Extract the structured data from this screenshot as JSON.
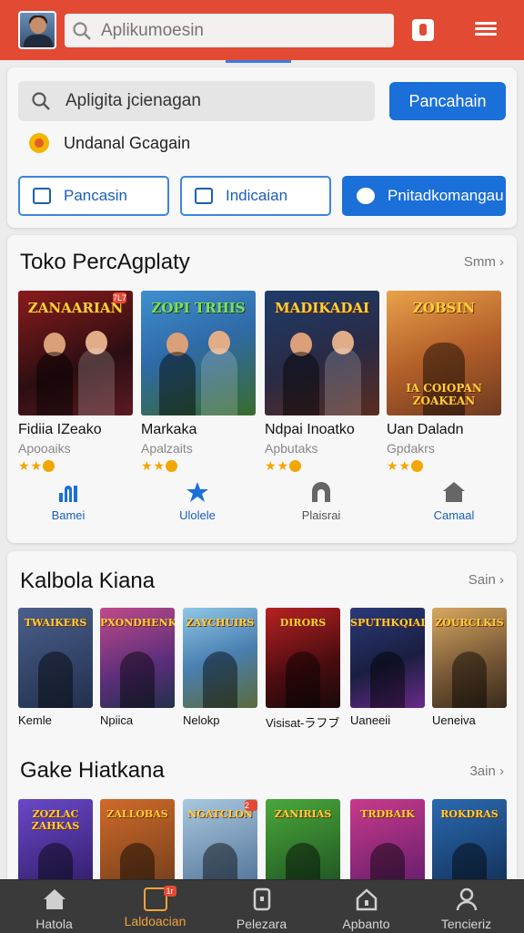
{
  "header": {
    "search_placeholder": "Aplikumoesin",
    "colors": {
      "bar": "#e24a33",
      "accent": "#1b6fd8"
    }
  },
  "search": {
    "value": "Apligita jcienagan",
    "button": "Pancahain",
    "suggestion": "Undanal Gcagain"
  },
  "chips": [
    {
      "label": "Pancasin",
      "icon": "list-icon"
    },
    {
      "label": "Indicaian",
      "icon": "square-icon"
    },
    {
      "label": "Pnitadkomangau",
      "icon": "person-icon"
    }
  ],
  "section1": {
    "title": "Toko PercAgplaty",
    "more": "Smm",
    "games": [
      {
        "art": "ZANAARIAN",
        "name": "Fidiia IZeako",
        "sub": "Apooaiks",
        "badge": "7L7"
      },
      {
        "art": "ZOPI TRHIS",
        "name": "Markaka",
        "sub": "Apalzaits"
      },
      {
        "art": "MADIKADAI",
        "name": "Ndpai Inoatko",
        "sub": "Apbutaks"
      },
      {
        "art": "ZOBSIN",
        "art2": "IA COIOPAN ZOAKEAN",
        "name": "Uan Daladn",
        "sub": "Gpdakrs"
      }
    ],
    "categories": [
      {
        "label": "Bamei",
        "icon": "signal-icon"
      },
      {
        "label": "Ulolele",
        "icon": "star-icon"
      },
      {
        "label": "Plaisrai",
        "icon": "arch-icon"
      },
      {
        "label": "Camaal",
        "icon": "home-icon"
      }
    ]
  },
  "section2": {
    "title": "Kalbola Kiana",
    "more": "Sain",
    "games": [
      {
        "art": "TWAIKERS",
        "name": "Kemle"
      },
      {
        "art": "PXONDHENK",
        "name": "Npiica"
      },
      {
        "art": "ZAYCHUIRS",
        "name": "Nelokp"
      },
      {
        "art": "DIRORS",
        "name": "Visisat-ラフブ"
      },
      {
        "art": "SPUTHKQIAI",
        "name": "Uaneeii"
      },
      {
        "art": "ZOURCLKIS",
        "name": "Ueneiva"
      }
    ]
  },
  "section3": {
    "title": "Gake Hiatkana",
    "more": "3ain",
    "games": [
      {
        "art": "ZOZLAC ZAHKAS"
      },
      {
        "art": "ZALLOBAS"
      },
      {
        "art": "NGATCLON",
        "badge": "2"
      },
      {
        "art": "ZANIRIAS"
      },
      {
        "art": "TRDBAIK"
      },
      {
        "art": "ROKDRAS"
      }
    ]
  },
  "bottom_nav": [
    {
      "label": "Hatola",
      "icon": "home-icon"
    },
    {
      "label": "Laldoacian",
      "icon": "games-icon",
      "badge": "1r",
      "active": true
    },
    {
      "label": "Pelezara",
      "icon": "phone-icon"
    },
    {
      "label": "Apbanto",
      "icon": "home-outline-icon"
    },
    {
      "label": "Tencieriz",
      "icon": "person-icon"
    }
  ]
}
